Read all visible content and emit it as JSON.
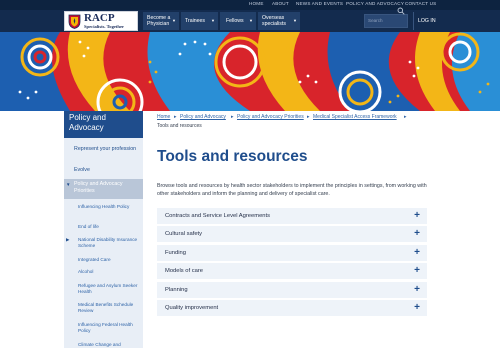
{
  "utility_nav": {
    "home": "HOME",
    "about": "ABOUT",
    "news": "NEWS AND EVENTS",
    "policy": "POLICY AND ADVOCACY",
    "contact": "CONTACT US"
  },
  "brand": {
    "name": "RACP",
    "tagline": "Specialists. Together"
  },
  "main_nav": {
    "physician": "Become a Physician",
    "trainees": "Trainees",
    "fellows": "Fellows",
    "overseas": "Overseas specialists",
    "search_placeholder": "Search",
    "login": "LOG IN"
  },
  "sidebar": {
    "title": "Policy and Advocacy",
    "items": [
      {
        "label": "Represent your profession"
      },
      {
        "label": "Evolve"
      },
      {
        "label": "Policy and Advocacy Priorities"
      }
    ],
    "sub_items": [
      {
        "label": "Influencing Health Policy"
      },
      {
        "label": "End of life"
      },
      {
        "label": "National Disability Insurance Scheme"
      },
      {
        "label": "Integrated Care"
      },
      {
        "label": "Alcohol"
      },
      {
        "label": "Refugee and Asylum Seeker Health"
      },
      {
        "label": "Medical Benefits Schedule Review"
      },
      {
        "label": "Influencing Federal Health Policy"
      },
      {
        "label": "Climate Change and"
      }
    ]
  },
  "breadcrumb": {
    "items": [
      {
        "label": "Home"
      },
      {
        "label": "Policy and Advocacy"
      },
      {
        "label": "Policy and Advocacy Priorities"
      },
      {
        "label": "Medical Specialist Access Framework"
      }
    ],
    "current": "Tools and resources"
  },
  "page": {
    "title": "Tools and resources",
    "intro": "Browse tools and resources by health sector stakeholders to implement the principles in settings, from working with other stakeholders and inform the planning and delivery of specialist care."
  },
  "accordion": [
    {
      "label": "Contracts and Service Level Agreements"
    },
    {
      "label": "Cultural safety"
    },
    {
      "label": "Funding"
    },
    {
      "label": "Models of care"
    },
    {
      "label": "Planning"
    },
    {
      "label": "Quality improvement"
    }
  ],
  "colors": {
    "navy": "#132b4e",
    "brand_blue": "#1f4d8c",
    "link_blue": "#2e63a7",
    "accordion_bg": "#eef3f9"
  }
}
